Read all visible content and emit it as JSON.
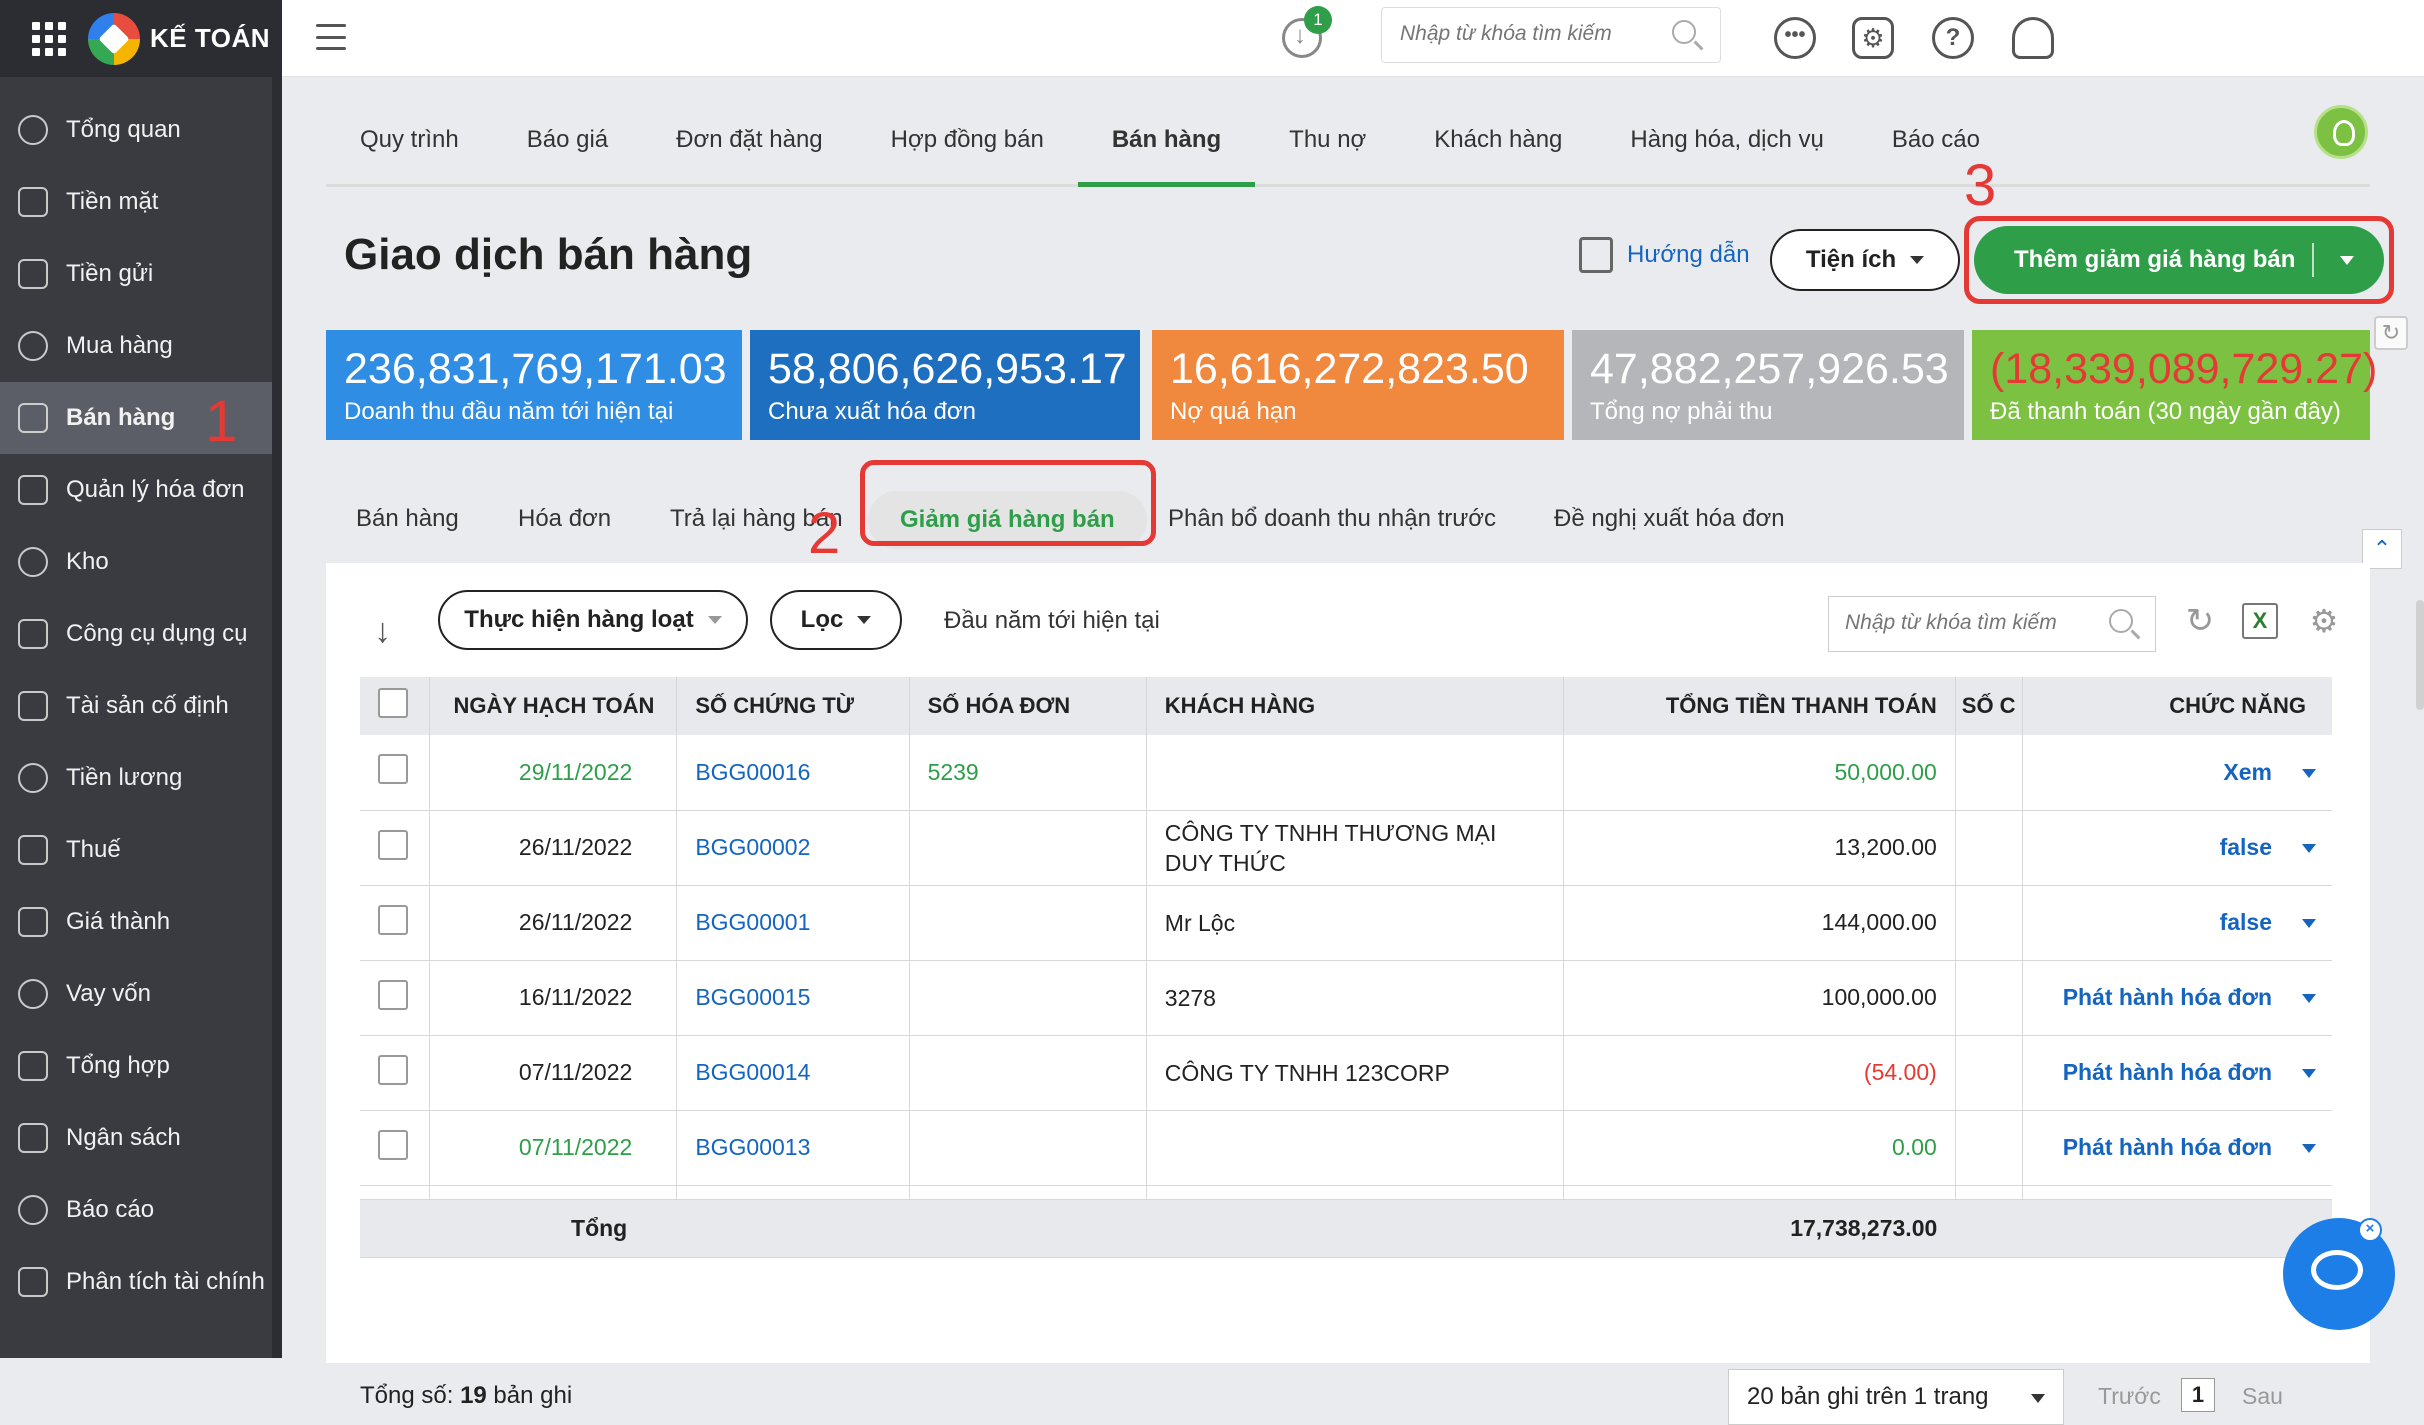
{
  "app": {
    "logo_text": "KẾ TOÁN"
  },
  "sidebar": {
    "items": [
      {
        "label": "Tổng quan",
        "icon": "gauge-icon"
      },
      {
        "label": "Tiền mặt",
        "icon": "money-bag-icon"
      },
      {
        "label": "Tiền gửi",
        "icon": "bank-icon"
      },
      {
        "label": "Mua hàng",
        "icon": "shopping-bag-icon"
      },
      {
        "label": "Bán hàng",
        "icon": "cart-icon",
        "active": true
      },
      {
        "label": "Quản lý hóa đơn",
        "icon": "invoice-icon"
      },
      {
        "label": "Kho",
        "icon": "warehouse-icon"
      },
      {
        "label": "Công cụ dụng cụ",
        "icon": "tools-icon"
      },
      {
        "label": "Tài sản cố định",
        "icon": "car-icon"
      },
      {
        "label": "Tiền lương",
        "icon": "payroll-icon"
      },
      {
        "label": "Thuế",
        "icon": "tax-icon"
      },
      {
        "label": "Giá thành",
        "icon": "price-tag-icon"
      },
      {
        "label": "Vay vốn",
        "icon": "loan-icon"
      },
      {
        "label": "Tổng hợp",
        "icon": "summary-icon"
      },
      {
        "label": "Ngân sách",
        "icon": "budget-icon"
      },
      {
        "label": "Báo cáo",
        "icon": "bar-chart-icon"
      },
      {
        "label": "Phân tích tài chính",
        "icon": "analytics-icon"
      }
    ]
  },
  "topbar": {
    "download_badge": "1",
    "search_placeholder": "Nhập từ khóa tìm kiếm"
  },
  "nav_tabs": [
    {
      "label": "Quy trình"
    },
    {
      "label": "Báo giá"
    },
    {
      "label": "Đơn đặt hàng"
    },
    {
      "label": "Hợp đồng bán"
    },
    {
      "label": "Bán hàng",
      "active": true
    },
    {
      "label": "Thu nợ"
    },
    {
      "label": "Khách hàng"
    },
    {
      "label": "Hàng hóa, dịch vụ"
    },
    {
      "label": "Báo cáo"
    }
  ],
  "header": {
    "title": "Giao dịch bán hàng",
    "guide": "Hướng dẫn",
    "utilities": "Tiện ích",
    "add_button": "Thêm giảm giá hàng bán"
  },
  "annotations": {
    "a1": "1",
    "a2": "2",
    "a3": "3"
  },
  "kpis": [
    {
      "value": "236,831,769,171.03",
      "label": "Doanh thu đầu năm tới hiện tại",
      "color": "#2f8de4"
    },
    {
      "value": "58,806,626,953.17",
      "label": "Chưa xuất hóa đơn",
      "color": "#1e6fc0"
    },
    {
      "value": "16,616,272,823.50",
      "label": "Nợ quá hạn",
      "color": "#f0883e"
    },
    {
      "value": "47,882,257,926.53",
      "label": "Tổng nợ phải thu",
      "color": "#b4b6ba"
    },
    {
      "value": "(18,339,089,729.27)",
      "label": "Đã thanh toán (30 ngày gần đây)",
      "color": "#7cc142",
      "value_color": "#e53935"
    }
  ],
  "subtabs": [
    {
      "label": "Bán hàng"
    },
    {
      "label": "Hóa đơn"
    },
    {
      "label": "Trả lại hàng bán"
    },
    {
      "label": "Giảm giá hàng bán",
      "active": true
    },
    {
      "label": "Phân bổ doanh thu nhận trước"
    },
    {
      "label": "Đề nghị xuất hóa đơn"
    }
  ],
  "toolbar": {
    "bulk_action": "Thực hiện hàng loạt",
    "filter": "Lọc",
    "period": "Đầu năm tới hiện tại",
    "search_placeholder": "Nhập từ khóa tìm kiếm"
  },
  "table": {
    "columns": [
      "NGÀY HẠCH TOÁN",
      "SỐ CHỨNG TỪ",
      "SỐ HÓA ĐƠN",
      "KHÁCH HÀNG",
      "TỔNG TIỀN THANH TOÁN",
      "SỐ C",
      "CHỨC NĂNG"
    ],
    "rows": [
      {
        "date": "29/11/2022",
        "doc": "BGG00016",
        "invoice": "5239",
        "customer": "",
        "total": "50,000.00",
        "fn": "Xem",
        "green": true
      },
      {
        "date": "26/11/2022",
        "doc": "BGG00002",
        "invoice": "",
        "customer": "CÔNG TY TNHH THƯƠNG MẠI DUY THỨC",
        "total": "13,200.00",
        "fn": "false"
      },
      {
        "date": "26/11/2022",
        "doc": "BGG00001",
        "invoice": "",
        "customer": "Mr Lộc",
        "total": "144,000.00",
        "fn": "false"
      },
      {
        "date": "16/11/2022",
        "doc": "BGG00015",
        "invoice": "",
        "customer": "3278",
        "total": "100,000.00",
        "fn": "Phát hành hóa đơn"
      },
      {
        "date": "07/11/2022",
        "doc": "BGG00014",
        "invoice": "",
        "customer": "CÔNG TY TNHH 123CORP",
        "total": "(54.00)",
        "fn": "Phát hành hóa đơn",
        "negative": true
      },
      {
        "date": "07/11/2022",
        "doc": "BGG00013",
        "invoice": "",
        "customer": "",
        "total": "0.00",
        "fn": "Phát hành hóa đơn",
        "green": true
      }
    ],
    "sum_label": "Tổng",
    "sum_total": "17,738,273.00"
  },
  "footer": {
    "total_prefix": "Tổng số: ",
    "total_count": "19",
    "total_suffix": " bản ghi",
    "per_page": "20 bản ghi trên 1 trang",
    "prev": "Trước",
    "page": "1",
    "next": "Sau"
  }
}
